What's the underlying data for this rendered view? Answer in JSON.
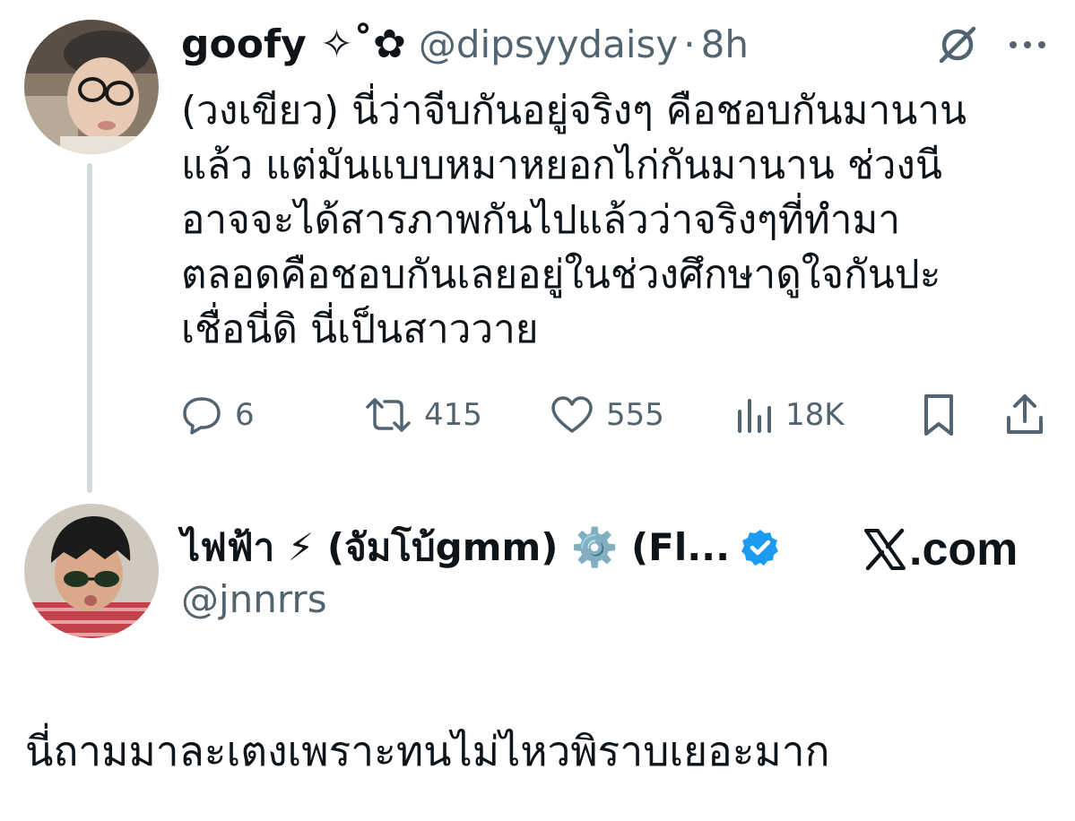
{
  "tweet": {
    "author_name": "goofy ✧˚✿",
    "author_handle": "@dipsyydaisy",
    "separator": "·",
    "time": "8h",
    "body_lines": [
      "(วงเขียว) นี่ว่าจีบกันอยู่จริงๆ คือชอบกันมานาน",
      "แล้ว แต่มันแบบหมาหยอกไก่กันมานาน ช่วงนี",
      "อาจจะได้สารภาพกันไปแล้วว่าจริงๆที่ทำมา",
      "ตลอดคือชอบกันเลยอยู่ในช่วงศึกษาดูใจกันปะ",
      "เชื่อนี่ดิ นี่เป็นสาววาย"
    ],
    "actions": {
      "replies": "6",
      "reposts": "415",
      "likes": "555",
      "views": "18K"
    }
  },
  "quoted_user": {
    "name": "ไฟฟ้า ⚡ (จัมโบ้gmm) ⚙️ (Fl...",
    "handle": "@jnnrrs",
    "verified": true,
    "verified_color": "#1d9bf0"
  },
  "source_badge": {
    "logo": "x-logo-icon",
    "text": ".com"
  },
  "caption": "นี่ถามมาละเตงเพราะทนไม่ไหวพิราบเยอะมาก",
  "colors": {
    "text_primary": "#0f1419",
    "text_secondary": "#536471",
    "thread_line": "#cfd9de",
    "verified": "#1d9bf0"
  }
}
